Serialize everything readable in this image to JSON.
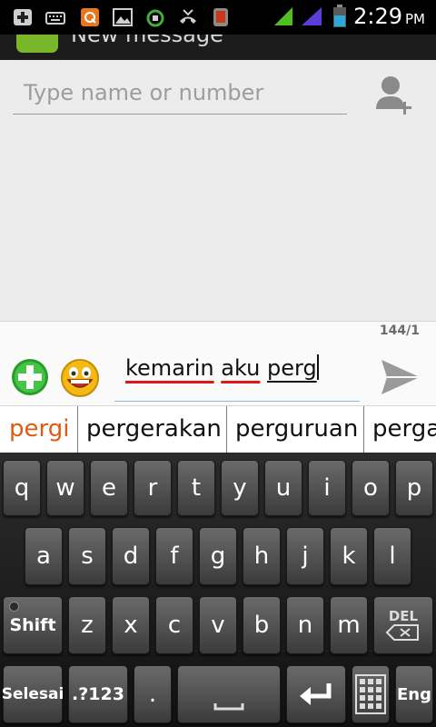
{
  "status_bar": {
    "time": "2:29",
    "ampm": "PM",
    "left_icons": [
      "add-notification-icon",
      "keyboard-icon",
      "q-app-icon",
      "image-icon",
      "sync-icon",
      "missed-call-icon",
      "phone-app-icon"
    ],
    "right_icons": [
      "signal-green-icon",
      "signal-purple-icon",
      "battery-icon"
    ]
  },
  "action_bar": {
    "title": "New message"
  },
  "recipient": {
    "placeholder": "Type name or number",
    "add_contact_icon": "add-contact-icon"
  },
  "compose": {
    "char_count": "144/1",
    "words": [
      "kemarin",
      "aku",
      "perg"
    ],
    "attach_icon": "add-attachment-icon",
    "emoji_icon": "smiley-icon",
    "send_icon": "send-icon"
  },
  "suggestions": [
    "pergi",
    "pergerakan",
    "perguruan",
    "perga"
  ],
  "keyboard": {
    "row1": [
      "q",
      "w",
      "e",
      "r",
      "t",
      "y",
      "u",
      "i",
      "o",
      "p"
    ],
    "row2": [
      "a",
      "s",
      "d",
      "f",
      "g",
      "h",
      "j",
      "k",
      "l"
    ],
    "row3": [
      "z",
      "x",
      "c",
      "v",
      "b",
      "n",
      "m"
    ],
    "shift": "Shift",
    "del": "DEL",
    "done": "Selesai",
    "symbols": ".?123",
    "period": ".",
    "lang": "Eng",
    "enter_icon": "enter-icon",
    "grid_icon": "keypad-grid-icon",
    "space_icon": "space-icon"
  },
  "colors": {
    "suggestion_highlight": "#e05a12",
    "spell_underline": "#e01818",
    "accent": "#7fc4dc"
  }
}
